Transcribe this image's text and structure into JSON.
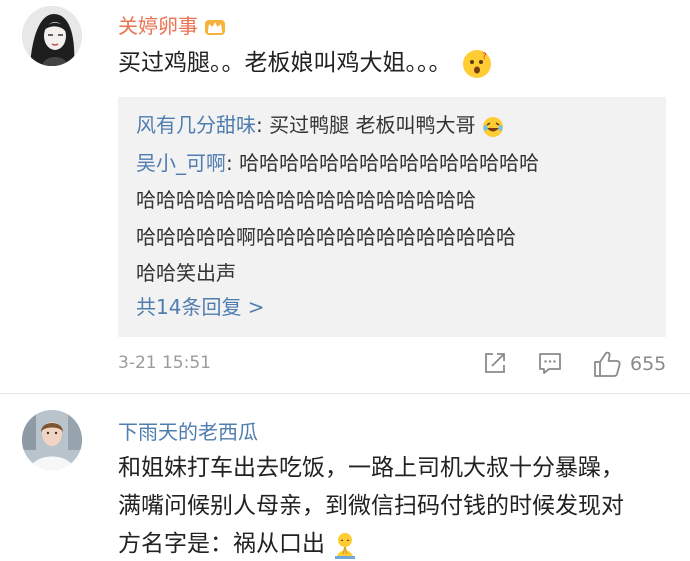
{
  "comment1": {
    "username": "关婷卵事",
    "text": "买过鸡腿。。老板娘叫鸡大姐。。。",
    "badge_icon": "crown-icon",
    "emoji_icon": "thinking-face-emoji"
  },
  "replies": {
    "reply1": {
      "name": "风有几分甜味",
      "text": ": 买过鸭腿 老板叫鸭大哥",
      "emoji_icon": "laughing-tears-emoji"
    },
    "reply2": {
      "name": "吴小_可啊",
      "line1": ": 哈哈哈哈哈哈哈哈哈哈哈哈哈哈哈",
      "line2": "哈哈哈哈哈哈哈哈哈哈哈哈哈哈哈哈哈",
      "line3": "哈哈哈哈哈啊哈哈哈哈哈哈哈哈哈哈哈哈哈",
      "line4": "哈哈笑出声"
    },
    "count_label": "共14条回复 >"
  },
  "meta": {
    "timestamp": "3-21 15:51",
    "like_count": "655"
  },
  "comment2": {
    "username": "下雨天的老西瓜",
    "line1": "和姐妹打车出去吃饭，一路上司机大叔十分暴躁，",
    "line2": "满嘴问候别人母亲，到微信扫码付钱的时候发现对",
    "line3": "方名字是：祸从口出",
    "emoji_icon": "praying-figure-emoji"
  },
  "colors": {
    "vip_name": "#eb7350",
    "link_blue": "#507daf",
    "reply_bg": "#f2f2f2",
    "meta_gray": "#9b9b9b"
  }
}
